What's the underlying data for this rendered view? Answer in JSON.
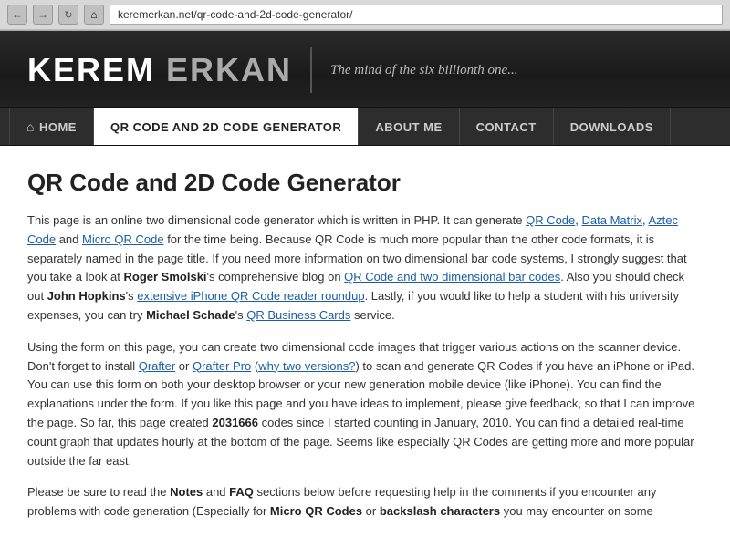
{
  "browser": {
    "url": "keremerkan.net/qr-code-and-2d-code-generator/"
  },
  "header": {
    "logo_part1": "KEREM",
    "logo_part2": "ERKAN",
    "tagline": "The mind of the six billionth one..."
  },
  "nav": {
    "items": [
      {
        "id": "home",
        "label": "HOME",
        "active": false,
        "has_icon": true
      },
      {
        "id": "qr-code",
        "label": "QR CODE AND 2D CODE GENERATOR",
        "active": true,
        "has_icon": false
      },
      {
        "id": "about",
        "label": "ABOUT ME",
        "active": false,
        "has_icon": false
      },
      {
        "id": "contact",
        "label": "CONTACT",
        "active": false,
        "has_icon": false
      },
      {
        "id": "downloads",
        "label": "DOWNLOADS",
        "active": false,
        "has_icon": false
      }
    ]
  },
  "content": {
    "title": "QR Code and 2D Code Generator",
    "paragraph1": "This page is an online two dimensional code generator which is written in PHP. It can generate QR Code, Data Matrix, Aztec Code and Micro QR Code for the time being. Because QR Code is much more popular than the other code formats, it is separately named in the page title. If you need more information on two dimensional bar code systems, I strongly suggest that you take a look at Roger Smolski's comprehensive blog on QR Code and two dimensional bar codes. Also you should check out John Hopkins's extensive iPhone QR Code reader roundup. Lastly, if you would like to help a student with his university expenses, you can try Michael Schade's QR Business Cards service.",
    "paragraph2": "Using the form on this page, you can create two dimensional code images that trigger various actions on the scanner device. Don't forget to install Qrafter or Qrafter Pro (why two versions?) to scan and generate QR Codes if you have an iPhone or iPad. You can use this form on both your desktop browser or your new generation mobile device (like iPhone). You can find the explanations under the form. If you like this page and you have ideas to implement, please give feedback, so that I can improve the page. So far, this page created 2031666 codes since I started counting in January, 2010. You can find a detailed real-time count graph that updates hourly at the bottom of the page. Seems like especially QR Codes are getting more and more popular outside the far east.",
    "paragraph3": "Please be sure to read the Notes and FAQ sections below before requesting help in the comments if you encounter any problems with code generation (Especially for Micro QR Codes or backslash characters you may encounter on some"
  }
}
